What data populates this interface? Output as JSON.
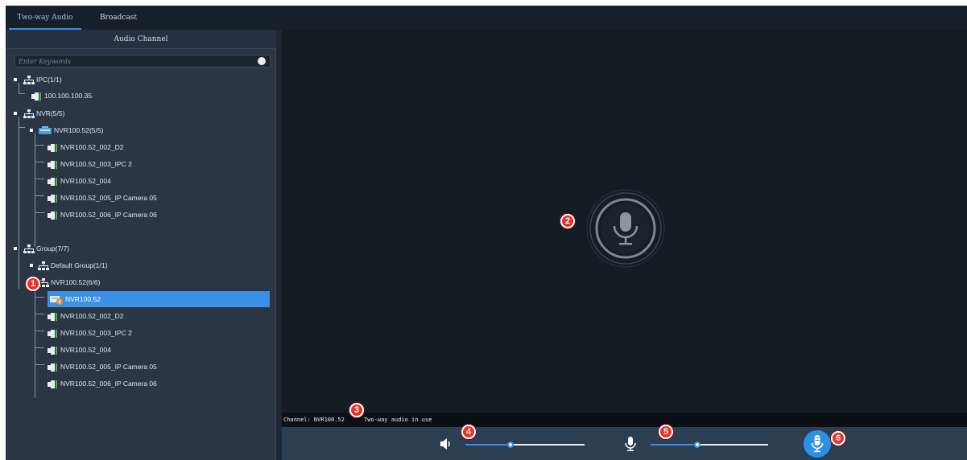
{
  "tabs": [
    {
      "label": "Two-way Audio",
      "active": true
    },
    {
      "label": "Broadcast",
      "active": false
    }
  ],
  "panel": {
    "title": "Audio Channel",
    "search_placeholder": "Enter Keywords"
  },
  "tree": {
    "ipc_group": "IPC(1/1)",
    "ipc_device": "100.100.100.35",
    "nvr_group": "NVR(5/5)",
    "nvr_device": "NVR100.52(5/5)",
    "nvr_channels": [
      "NVR100.52_002_D2",
      "NVR100.52_003_IPC 2",
      "NVR100.52_004",
      "NVR100.52_005_IP Camera 05",
      "NVR100.52_006_IP Camera 06"
    ],
    "group_root": "Group(7/7)",
    "default_group": "Default Group(1/1)",
    "nvr_subgroup": "NVR100.52(6/6)",
    "selected_item": "NVR100.52",
    "group_channels": [
      "NVR100.52_002_D2",
      "NVR100.52_003_IPC 2",
      "NVR100.52_004",
      "NVR100.52_005_IP Camera 05",
      "NVR100.52_006_IP Camera 06"
    ]
  },
  "status": {
    "channel": "Channel: NVR100.52",
    "message": "Two-way audio in use"
  },
  "controls": {
    "speaker_volume": 0.38,
    "mic_volume": 0.4
  },
  "callouts": [
    "1",
    "2",
    "3",
    "4",
    "5",
    "6"
  ],
  "colors": {
    "accent": "#3a8ee6",
    "callout": "#e8322a",
    "panel_bg": "#2a3644",
    "viewer_bg": "#141c26"
  }
}
